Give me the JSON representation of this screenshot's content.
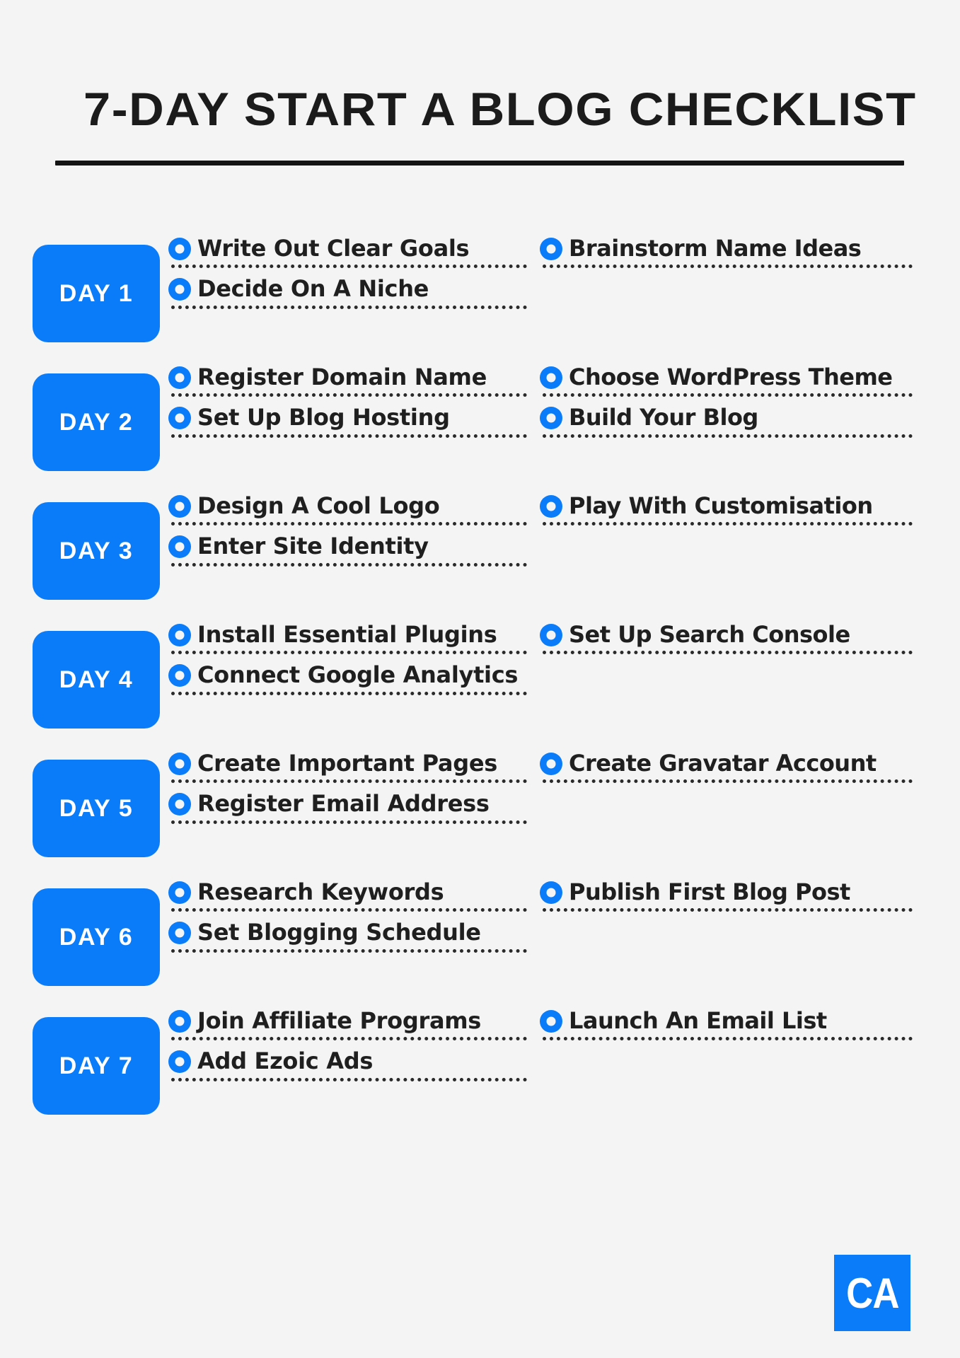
{
  "header": {
    "title": "7-DAY START A BLOG CHECKLIST"
  },
  "colors": {
    "accent_blue": "#0a7cfa",
    "background": "#f4f4f4",
    "text_dark": "#1f1f1f"
  },
  "days": [
    {
      "badge": "DAY 1",
      "left": [
        "Write Out Clear Goals",
        "Decide On A Niche"
      ],
      "right": [
        "Brainstorm Name Ideas"
      ]
    },
    {
      "badge": "DAY 2",
      "left": [
        "Register Domain Name",
        "Set Up Blog Hosting"
      ],
      "right": [
        "Choose WordPress Theme",
        "Build Your Blog"
      ]
    },
    {
      "badge": "DAY 3",
      "left": [
        "Design A Cool Logo",
        "Enter Site Identity"
      ],
      "right": [
        "Play With Customisation"
      ]
    },
    {
      "badge": "DAY 4",
      "left": [
        "Install Essential Plugins",
        "Connect Google Analytics"
      ],
      "right": [
        "Set Up Search Console"
      ]
    },
    {
      "badge": "DAY 5",
      "left": [
        "Create Important Pages",
        "Register Email Address"
      ],
      "right": [
        "Create Gravatar Account"
      ]
    },
    {
      "badge": "DAY 6",
      "left": [
        "Research Keywords",
        "Set Blogging Schedule"
      ],
      "right": [
        "Publish First Blog Post"
      ]
    },
    {
      "badge": "DAY 7",
      "left": [
        "Join Affiliate Programs",
        "Add Ezoic Ads"
      ],
      "right": [
        "Launch An Email List"
      ]
    }
  ],
  "logo": {
    "text": "CA"
  }
}
